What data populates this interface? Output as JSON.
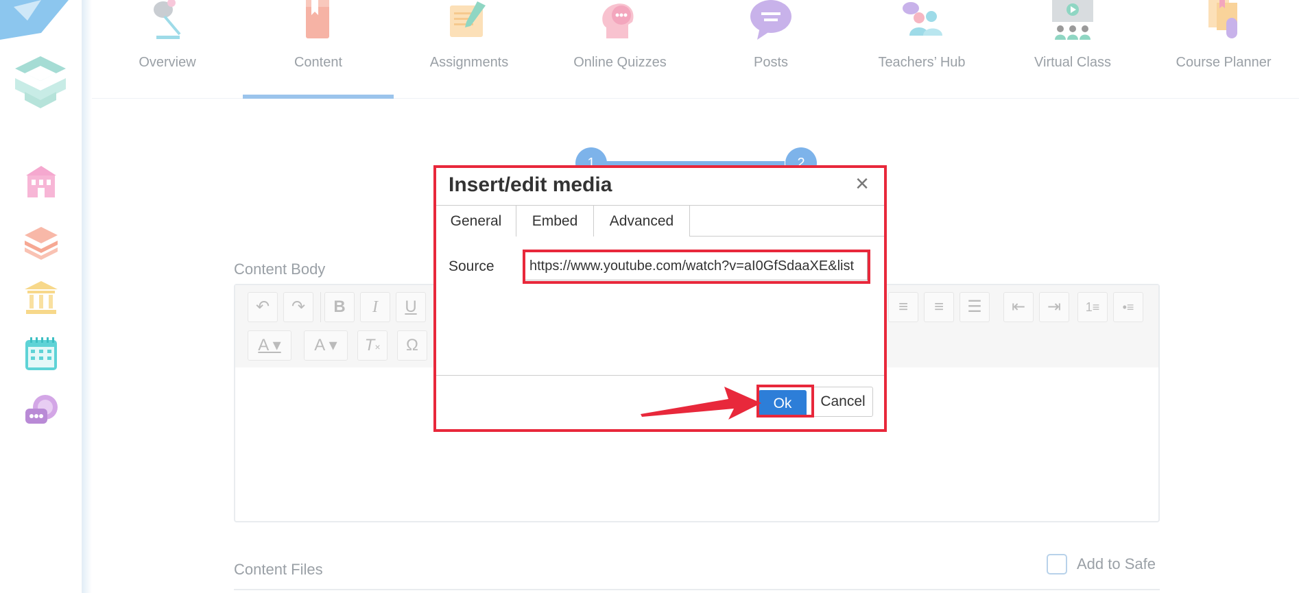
{
  "nav": {
    "items": [
      {
        "label": "Overview",
        "icon": "lamp-icon"
      },
      {
        "label": "Content",
        "icon": "book-icon",
        "active": true
      },
      {
        "label": "Assignments",
        "icon": "pen-paper-icon"
      },
      {
        "label": "Online Quizzes",
        "icon": "head-chat-icon"
      },
      {
        "label": "Posts",
        "icon": "speech-bubble-icon"
      },
      {
        "label": "Teachers’ Hub",
        "icon": "people-group-icon"
      },
      {
        "label": "Virtual Class",
        "icon": "video-board-icon"
      },
      {
        "label": "Course Planner",
        "icon": "planner-icon"
      }
    ]
  },
  "steps": [
    "1",
    "2"
  ],
  "content_body_label": "Content Body",
  "content_files_label": "Content Files",
  "add_to_safe_label": "Add to Safe",
  "dialog": {
    "title": "Insert/edit media",
    "close_symbol": "×",
    "tabs": [
      "General",
      "Embed",
      "Advanced"
    ],
    "source_label": "Source",
    "source_value": "https://www.youtube.com/watch?v=aI0GfSdaaXE&list",
    "ok_label": "Ok",
    "cancel_label": "Cancel"
  },
  "toolbar": {
    "row1": [
      "undo-icon",
      "redo-icon",
      "bold-icon",
      "italic-icon",
      "underline-icon",
      "align-center-icon",
      "align-right-icon",
      "align-justify-icon",
      "outdent-icon",
      "indent-icon",
      "numbered-list-icon",
      "bullet-list-icon"
    ],
    "row2": [
      "text-color-icon",
      "background-color-icon",
      "clear-format-icon",
      "special-char-icon"
    ]
  },
  "colors": {
    "accent": "#7db3ea",
    "annotation": "#e8283b",
    "ok_button": "#2d7ed8"
  }
}
